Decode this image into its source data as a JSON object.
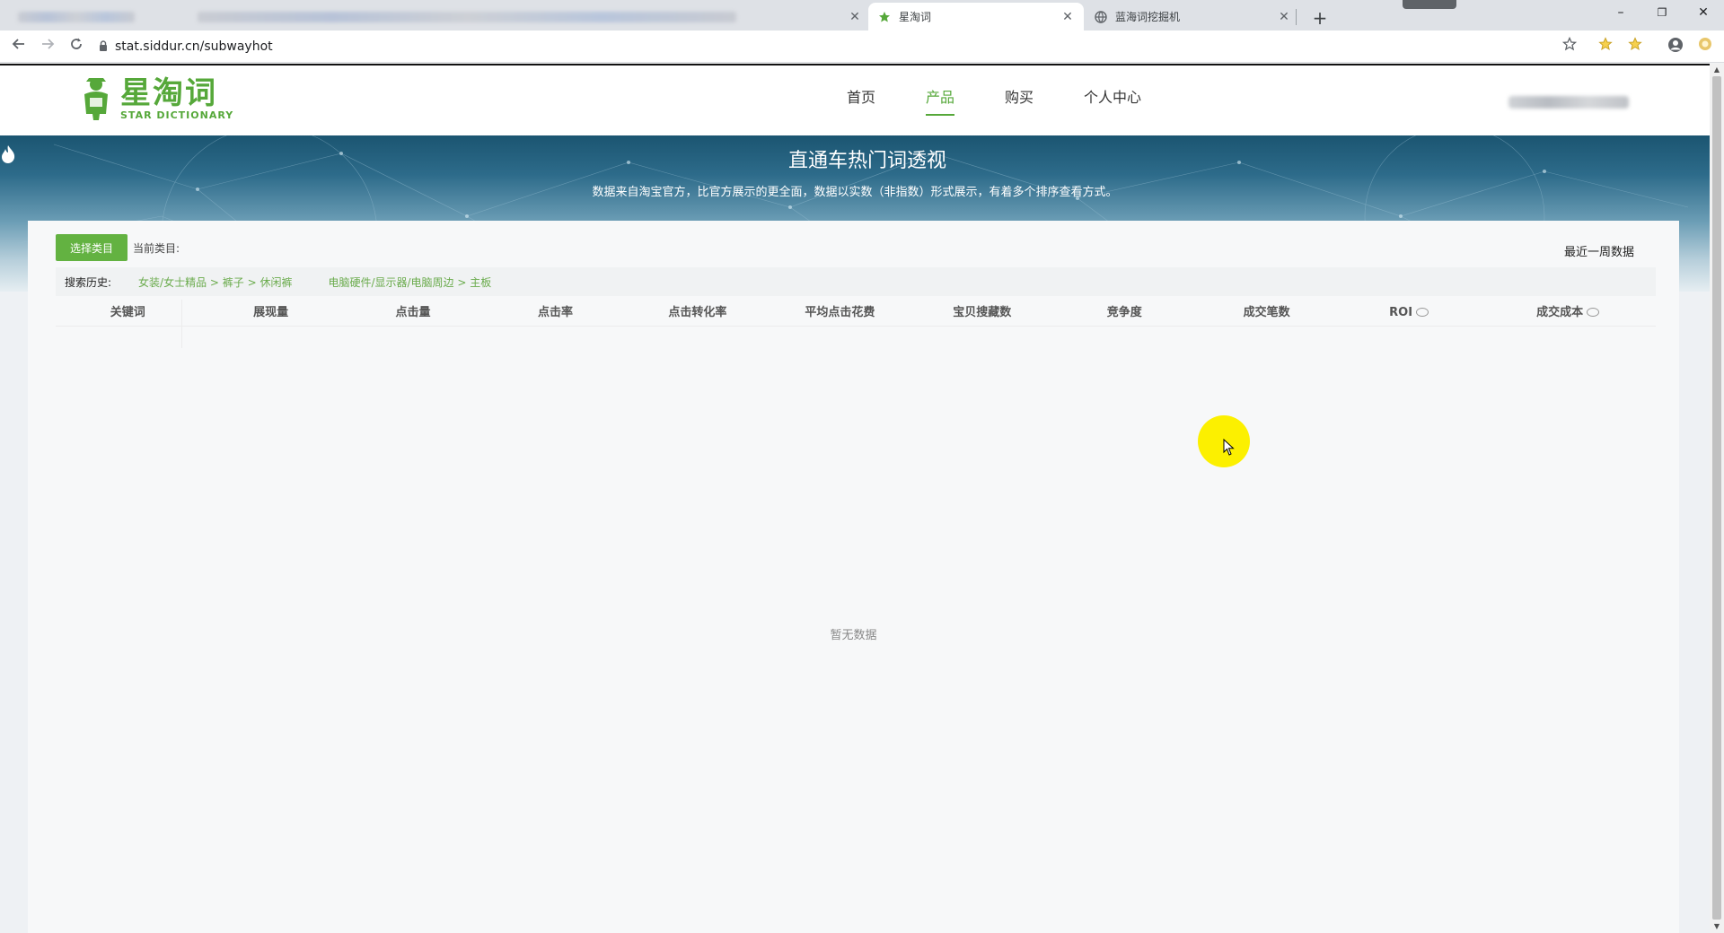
{
  "browser": {
    "tabs": [
      {
        "label": "",
        "blurred": true
      },
      {
        "label": "",
        "blurred": true
      },
      {
        "label": "星淘词",
        "active": true
      },
      {
        "label": "蓝海词挖掘机"
      }
    ],
    "new_tab_glyph": "+",
    "window_controls": {
      "minimize": "–",
      "restore": "❐",
      "close": "✕"
    },
    "url": "stat.siddur.cn/subwayhot",
    "icons": [
      "back-icon",
      "forward-icon",
      "reload-icon",
      "lock-icon",
      "bookmark-star-icon",
      "extension-star-icon",
      "account-icon",
      "extension-icon"
    ]
  },
  "site": {
    "logo_cn": "星淘词",
    "logo_en": "STAR DICTIONARY",
    "nav": [
      {
        "label": "首页",
        "active": false
      },
      {
        "label": "产品",
        "active": true
      },
      {
        "label": "购买",
        "active": false
      },
      {
        "label": "个人中心",
        "active": false
      }
    ]
  },
  "banner": {
    "title": "直通车热门词透视",
    "subtitle": "数据来自淘宝官方，比官方展示的更全面，数据以实数（非指数）形式展示，有着多个排序查看方式。"
  },
  "panel": {
    "select_button": "选择类目",
    "current_category_label": "当前类目:",
    "recent_label": "最近一周数据",
    "history_label": "搜索历史:",
    "history_links": [
      "女装/女士精品 > 裤子 > 休闲裤",
      "电脑硬件/显示器/电脑周边 > 主板"
    ],
    "columns": [
      "关键词",
      "展现量",
      "点击量",
      "点击率",
      "点击转化率",
      "平均点击花费",
      "宝贝搜藏数",
      "竞争度",
      "成交笔数",
      "ROI",
      "成交成本"
    ],
    "empty_text": "暂无数据"
  },
  "colors": {
    "brand_green": "#56a83a",
    "button_green": "#63b241",
    "link_green": "#6aab4c",
    "cursor_highlight": "#fcf000"
  }
}
